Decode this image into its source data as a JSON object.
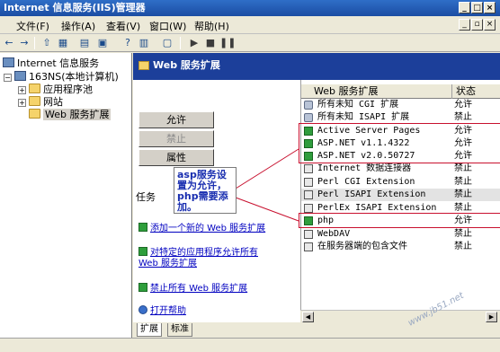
{
  "window": {
    "title": "Internet 信息服务(IIS)管理器"
  },
  "menu": [
    "文件(F)",
    "操作(A)",
    "查看(V)",
    "窗口(W)",
    "帮助(H)"
  ],
  "tree": {
    "root": "Internet 信息服务",
    "computer": "163NS(本地计算机)",
    "children": [
      "应用程序池",
      "网站",
      "Web 服务扩展"
    ]
  },
  "banner": {
    "title": "Web 服务扩展"
  },
  "buttons": {
    "allow": "允许",
    "prohibit": "禁止",
    "properties": "属性"
  },
  "tasks_label": "任务",
  "task_links": {
    "add_new": "添加一个新的 Web 服务扩展",
    "allow_app_line1": "对特定的应用程序允许所有",
    "allow_app_line2": "Web 服务扩展",
    "prohibit_all": "禁止所有 Web 服务扩展",
    "help": "打开帮助"
  },
  "list": {
    "col_name": "Web 服务扩展",
    "col_status": "状态",
    "rows": [
      {
        "name": "所有未知 CGI 扩展",
        "status": "允许"
      },
      {
        "name": "所有未知 ISAPI 扩展",
        "status": "禁止"
      },
      {
        "name": "Active Server Pages",
        "status": "允许"
      },
      {
        "name": "ASP.NET v1.1.4322",
        "status": "允许"
      },
      {
        "name": "ASP.NET v2.0.50727",
        "status": "允许"
      },
      {
        "name": "Internet 数据连接器",
        "status": "禁止"
      },
      {
        "name": "Perl CGI Extension",
        "status": "禁止"
      },
      {
        "name": "Perl ISAPI Extension",
        "status": "禁止"
      },
      {
        "name": "PerlEx ISAPI Extension",
        "status": "禁止"
      },
      {
        "name": "php",
        "status": "允许"
      },
      {
        "name": "WebDAV",
        "status": "禁止"
      },
      {
        "name": "在服务器端的包含文件",
        "status": "禁止"
      }
    ]
  },
  "callout": {
    "text": "asp服务设置为允许，php需要添加。"
  },
  "tabs": [
    "扩展",
    "标准"
  ],
  "watermark": "www.jb51.net",
  "colors": {
    "banner": "#1c3f9a",
    "annotation": "#c8102e",
    "callout_text": "#1a2fb0"
  }
}
